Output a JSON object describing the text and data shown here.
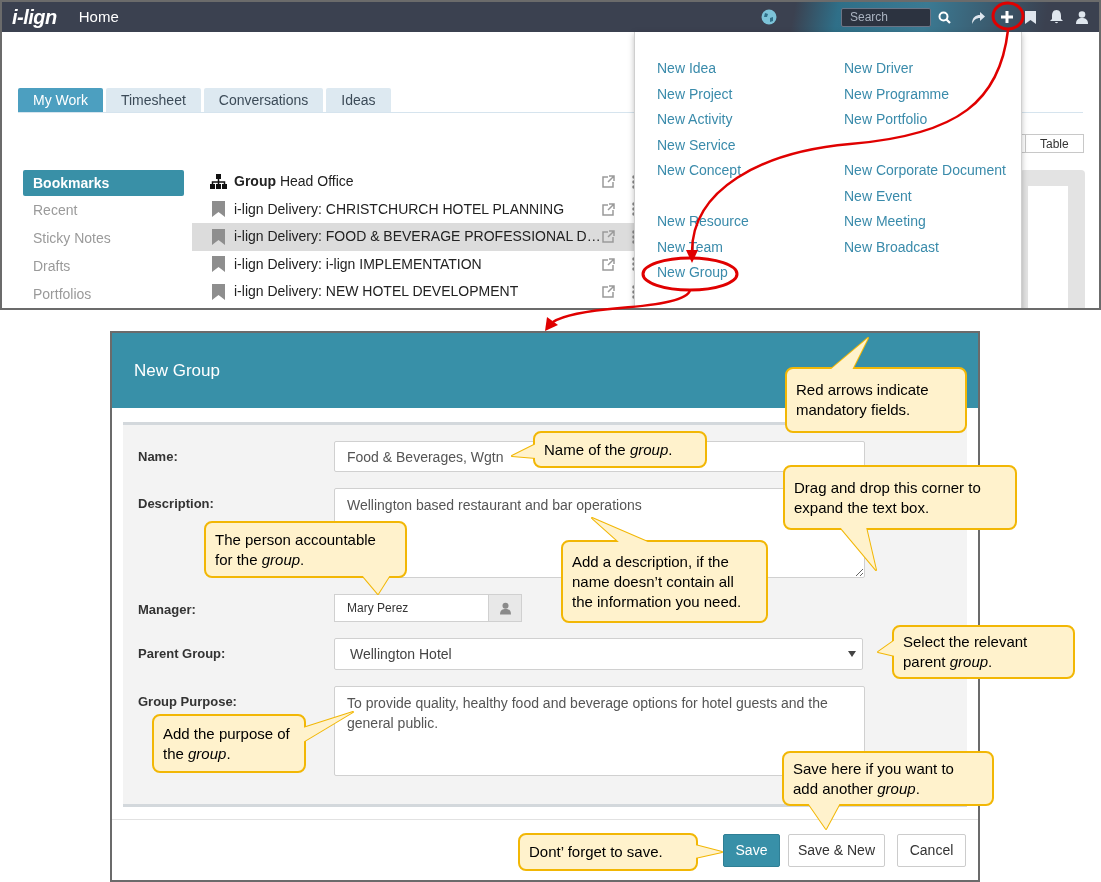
{
  "top_screen": {
    "nav": {
      "logo": "i-lign",
      "title": "Home",
      "search": {
        "placeholder": "Search"
      }
    },
    "tabs": [
      {
        "label": "My Work",
        "selected": true
      },
      {
        "label": "Timesheet",
        "selected": false
      },
      {
        "label": "Conversations",
        "selected": false
      },
      {
        "label": "Ideas",
        "selected": false
      }
    ],
    "sidebar": {
      "items": [
        {
          "label": "Bookmarks",
          "selected": true
        },
        {
          "label": "Recent",
          "selected": false
        },
        {
          "label": "Sticky Notes",
          "selected": false
        },
        {
          "label": "Drafts",
          "selected": false
        },
        {
          "label": "Portfolios",
          "selected": false
        }
      ]
    },
    "bookmarks": [
      {
        "kind": "group",
        "label": "**Group** Head Office",
        "selected": false
      },
      {
        "kind": "bookmark",
        "label": "i-lign Delivery: CHRISTCHURCH HOTEL PLANNING",
        "selected": false
      },
      {
        "kind": "bookmark",
        "label": "i-lign Delivery: FOOD & BEVERAGE PROFESSIONAL D…",
        "selected": true
      },
      {
        "kind": "bookmark",
        "label": "i-lign Delivery: i-lign IMPLEMENTATION",
        "selected": false
      },
      {
        "kind": "bookmark",
        "label": "i-lign Delivery: NEW HOTEL DEVELOPMENT",
        "selected": false
      }
    ],
    "view_buttons": [
      "Table"
    ],
    "new_menu": {
      "columns": [
        {
          "groups": [
            [
              "New Idea",
              "New Project",
              "New Activity",
              "New Service",
              "New Concept"
            ],
            [
              "New Resource",
              "New Team",
              "New Group"
            ]
          ]
        },
        {
          "groups": [
            [
              "New Driver",
              "New Programme",
              "New Portfolio"
            ],
            [
              "New Corporate Document",
              "New Event",
              "New Meeting",
              "New Broadcast"
            ]
          ]
        }
      ]
    }
  },
  "dialog": {
    "title": "New Group",
    "fields": [
      {
        "label": "Name:",
        "kind": "input",
        "value": "Food & Beverages, Wgtn"
      },
      {
        "label": "Description:",
        "kind": "textarea",
        "value": "Wellington based restaurant and bar operations"
      },
      {
        "label": "Manager:",
        "kind": "lookup",
        "value": "Mary Perez"
      },
      {
        "label": "Parent Group:",
        "kind": "select",
        "value": "Wellington Hotel"
      },
      {
        "label": "Group Purpose:",
        "kind": "textarea",
        "value": "To provide quality, healthy food and beverage options for hotel guests and the general public."
      }
    ],
    "buttons": [
      {
        "label": "Save",
        "kind": "primary"
      },
      {
        "label": "Save & New",
        "kind": "default"
      },
      {
        "label": "Cancel",
        "kind": "default"
      }
    ]
  },
  "callouts": [
    {
      "text": "Red arrows indicate mandatory fields."
    },
    {
      "text": "Name of the *group*."
    },
    {
      "text": "Drag and drop this corner to expand the text box."
    },
    {
      "text": "The person accountable for the *group*."
    },
    {
      "text": "Add a description, if the name doesn’t contain all the information you need."
    },
    {
      "text": "Select the relevant parent *group*."
    },
    {
      "text": "Add the purpose of the *group*."
    },
    {
      "text": "Save here if you want to add another *group*."
    },
    {
      "text": "Dont’ forget to save."
    }
  ]
}
